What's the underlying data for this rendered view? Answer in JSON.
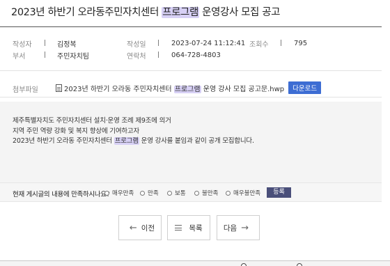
{
  "post": {
    "title_before": "2023년 하반기 오라동주민자치센터 ",
    "title_highlight": "프로그램",
    "title_after": " 운영강사 모집 공고"
  },
  "meta": {
    "author_label": "작성자",
    "author_value": "김정복",
    "date_label": "작성일",
    "date_value": "2023-07-24 11:12:41",
    "views_label": "조회수",
    "views_value": "795",
    "dept_label": "부서",
    "dept_value": "주민자치팀",
    "contact_label": "연락처",
    "contact_value": "064-728-4803",
    "separator": "|"
  },
  "attachment": {
    "label": "첨부파일",
    "name_before": "2023년 하반기 오라동 주민자치센터 ",
    "name_highlight": "프로그램",
    "name_after": " 운영 강사 모집 공고문.hwp",
    "download_label": "다운로드"
  },
  "content": {
    "line1": "제주특별자치도 주민자치센터 설치·운영 조례 제9조에 의거",
    "line2": "지역 주민 역량 강화 및 복지 향상에 기여하고자",
    "line3_before": "2023년 하반기 오라동 주민자치센터 ",
    "line3_highlight": "프로그램",
    "line3_after": " 운영 강사를 붙임과 같이 공개 모집합니다."
  },
  "survey": {
    "question": "현재 게시글의 내용에 만족하시나요?",
    "options": [
      "매우만족",
      "만족",
      "보통",
      "불만족",
      "매우불만족"
    ],
    "submit_label": "등록"
  },
  "nav": {
    "prev_label": "이전",
    "list_label": "목록",
    "next_label": "다음"
  },
  "icons": {
    "prev": "arrow-left-icon",
    "list": "list-icon",
    "next": "arrow-right-icon",
    "file": "document-icon"
  },
  "colors": {
    "highlight": "#d7d0f5",
    "download_button": "#3d6dd3",
    "submit_button": "#4a4f7a"
  }
}
